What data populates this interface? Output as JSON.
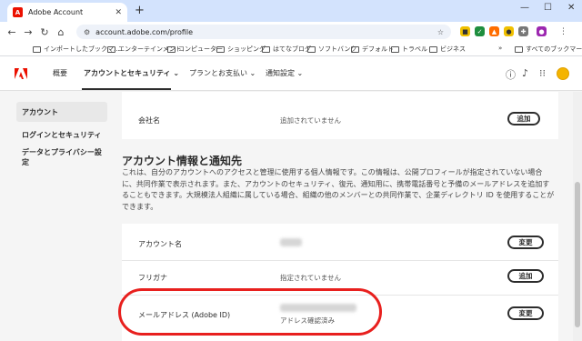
{
  "browser": {
    "tab_title": "Adobe Account",
    "tab_close": "✕",
    "new_tab": "+",
    "url": "account.adobe.com/profile",
    "window_min": "—",
    "window_max": "☐",
    "window_close": "✕"
  },
  "bookmarks": [
    "インポートしたブックマ...",
    "エンターテインメント",
    "コンピューター",
    "ショッピング",
    "はてなブログ",
    "ソフトバンク",
    "デフォルト",
    "トラベル",
    "ビジネス"
  ],
  "bookmarks_overflow": "»",
  "all_bookmarks": "すべてのブックマーク",
  "header": {
    "nav": [
      "概要",
      "アカウントとセキュリティ",
      "プランとお支払い",
      "通知設定"
    ],
    "chevron": "⌄"
  },
  "sidebar": {
    "items": [
      "アカウント",
      "ログインとセキュリティ",
      "データとプライバシー設定"
    ]
  },
  "company_row": {
    "label": "会社名",
    "value": "追加されていません",
    "button": "追加"
  },
  "section": {
    "title": "アカウント情報と通知先",
    "description": "これは、自分のアカウントへのアクセスと管理に使用する個人情報です。この情報は、公開プロフィールが指定されていない場合に、共同作業で表示されます。また、アカウントのセキュリティ、復元、通知用に、携帯電話番号と予備のメールアドレスを追加することもできます。大規模法人組織に属している場合、組織の他のメンバーとの共同作業で、企業ディレクトリ ID を使用することができます。"
  },
  "rows": [
    {
      "label": "アカウント名",
      "value": "",
      "button": "変更"
    },
    {
      "label": "フリガナ",
      "value": "指定されていません",
      "button": "追加"
    },
    {
      "label": "メールアドレス (Adobe ID)",
      "value": "アドレス確認済み",
      "button": "変更"
    }
  ],
  "colors": {
    "adobe_red": "#eb1000",
    "highlight": "#e8201e",
    "tabstrip": "#d3e3fd"
  }
}
